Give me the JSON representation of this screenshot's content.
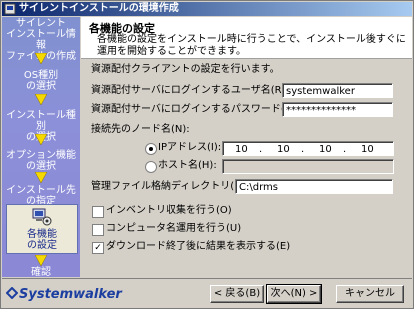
{
  "window": {
    "title": "サイレントインストールの環境作成"
  },
  "sidebar": {
    "steps": [
      {
        "label": "サイレント\nインストール情報\nファイルの作成"
      },
      {
        "label": "OS種別\nの選択"
      },
      {
        "label": "インストール種別\nの選択"
      },
      {
        "label": "オプション機能\nの選択"
      },
      {
        "label": "インストール先\nの指定"
      },
      {
        "label": "各機能\nの設定",
        "active": true
      },
      {
        "label": "確認"
      }
    ]
  },
  "header": {
    "title": "各機能の設定",
    "description": "各機能の設定をインストール時に行うことで、インストール後すぐに運用を開始することができます。"
  },
  "section": {
    "title": "資源配付クライアントの設定を行います。"
  },
  "form": {
    "user_label": "資源配付サーバにログインするユーザ名(R):",
    "user_value": "systemwalker",
    "password_label": "資源配付サーバにログインするパスワード(P):",
    "password_value": "**************",
    "node_label": "接続先のノード名(N):",
    "ip_label": "IPアドレス(I):",
    "ip": [
      "10",
      "10",
      "10",
      "10"
    ],
    "host_label": "ホスト名(H):",
    "host_value": "",
    "dir_label": "管理ファイル格納ディレクトリ(M):",
    "dir_value": "C:\\drms",
    "inventory_label": "インベントリ収集を行う(O)",
    "inventory_checked": false,
    "computer_label": "コンピュータ名運用を行う(U)",
    "computer_checked": false,
    "download_label": "ダウンロード終了後に結果を表示する(E)",
    "download_checked": true
  },
  "footer": {
    "logo": "Systemwalker",
    "back_label": "< 戻る(B)",
    "next_label": "次へ(N) >",
    "cancel_label": "キャンセル"
  },
  "colors": {
    "titlebar": "#0a246a",
    "sidebar": "#8b90d6",
    "arrow": "#f5d800",
    "logo": "#1b3ea0"
  }
}
